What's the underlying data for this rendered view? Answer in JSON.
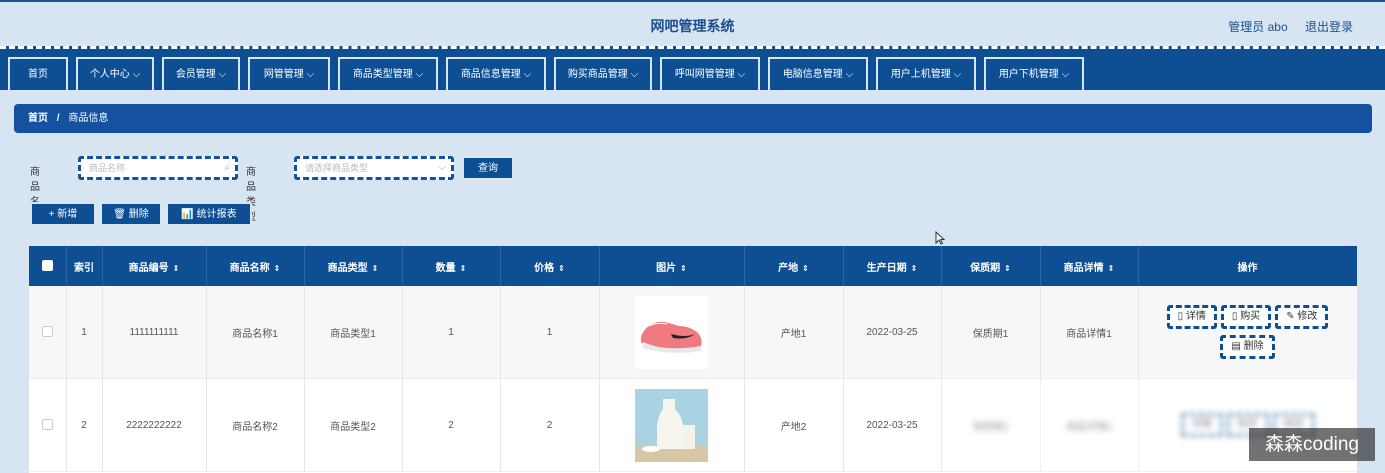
{
  "header": {
    "title": "网吧管理系统",
    "user_label": "管理员 abo",
    "logout_label": "退出登录"
  },
  "nav": {
    "items": [
      {
        "label": "首页"
      },
      {
        "label": "个人中心 ⌵"
      },
      {
        "label": "会员管理 ⌵"
      },
      {
        "label": "网管管理 ⌵"
      },
      {
        "label": "商品类型管理 ⌵"
      },
      {
        "label": "商品信息管理 ⌵"
      },
      {
        "label": "购买商品管理 ⌵"
      },
      {
        "label": "呼叫网管管理 ⌵"
      },
      {
        "label": "电脑信息管理 ⌵"
      },
      {
        "label": "用户上机管理 ⌵"
      },
      {
        "label": "用户下机管理 ⌵"
      }
    ]
  },
  "breadcrumb": {
    "home": "首页",
    "separator": "/",
    "current": "商品信息"
  },
  "search": {
    "name_label": "商品名称",
    "name_placeholder": "商品名称",
    "type_label": "商品类型",
    "type_placeholder": "请选择商品类型",
    "query_button": "查询"
  },
  "actions": {
    "add": "+ 新增",
    "delete": "🗑 删除",
    "report": "📊 统计报表"
  },
  "table": {
    "headers": {
      "index": "索引",
      "code": "商品编号",
      "name": "商品名称",
      "type": "商品类型",
      "qty": "数量",
      "price": "价格",
      "image": "图片",
      "origin": "产地",
      "date": "生产日期",
      "shelf": "保质期",
      "detail": "商品详情",
      "ops": "操作"
    },
    "sort_icon": "⇕",
    "rows": [
      {
        "index": "1",
        "code": "1111111111",
        "name": "商品名称1",
        "type": "商品类型1",
        "qty": "1",
        "price": "1",
        "image": "shoe-image",
        "origin": "产地1",
        "date": "2022-03-25",
        "shelf": "保质期1",
        "detail": "商品详情1"
      },
      {
        "index": "2",
        "code": "2222222222",
        "name": "商品名称2",
        "type": "商品类型2",
        "qty": "2",
        "price": "2",
        "image": "milk-image",
        "origin": "产地2",
        "date": "2022-03-25",
        "shelf": "保质期2",
        "detail": "商品详情2"
      }
    ],
    "row_ops": {
      "detail": "详情",
      "buy": "购买",
      "edit": "修改",
      "delete": "删除"
    }
  },
  "watermark": "森森coding",
  "colors": {
    "primary": "#0e4f94",
    "background": "#d7e5f2",
    "title": "#1b4e8c"
  }
}
